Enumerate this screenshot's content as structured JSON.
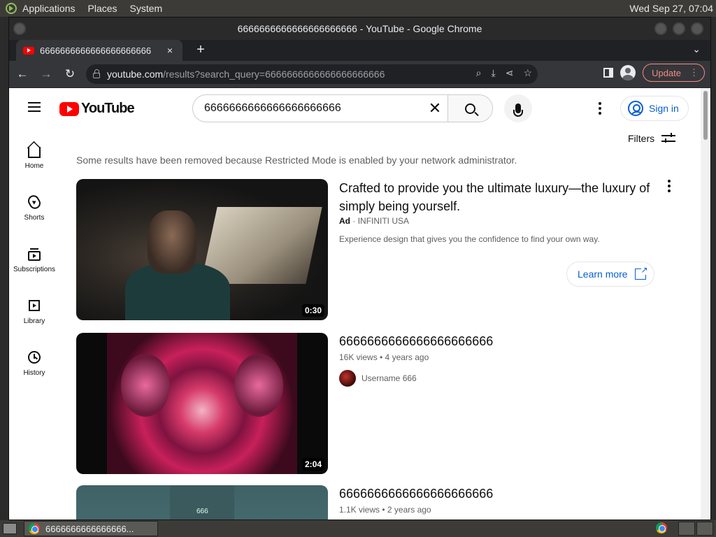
{
  "top_panel": {
    "menus": [
      "Applications",
      "Places",
      "System"
    ],
    "clock": "Wed Sep 27, 07:04"
  },
  "window": {
    "title": "6666666666666666666666 - YouTube - Google Chrome"
  },
  "tab": {
    "title": "6666666666666666666666",
    "close": "×",
    "new_tab": "+"
  },
  "omnibox": {
    "host": "youtube.com",
    "path": "/results?search_query=6666666666666666666666"
  },
  "toolbar": {
    "update_label": "Update"
  },
  "masthead": {
    "logo_text": "YouTube",
    "search_value": "6666666666666666666666",
    "signin_label": "Sign in"
  },
  "guide": [
    {
      "label": "Home",
      "icon": "home-icon"
    },
    {
      "label": "Shorts",
      "icon": "shorts-icon"
    },
    {
      "label": "Subscriptions",
      "icon": "subscriptions-icon"
    },
    {
      "label": "Library",
      "icon": "library-icon"
    },
    {
      "label": "History",
      "icon": "history-icon"
    }
  ],
  "filters_label": "Filters",
  "notice": "Some results have been removed because Restricted Mode is enabled by your network administrator.",
  "ad": {
    "title": "Crafted to provide you the ultimate luxury—the luxury of simply being yourself.",
    "ad_label": "Ad",
    "sep": "·",
    "advertiser": "INFINITI USA",
    "description": "Experience design that gives you the confidence to find your own way.",
    "duration": "0:30",
    "learn_more": "Learn more"
  },
  "videos": [
    {
      "title": "6666666666666666666666",
      "meta": "16K views • 4 years ago",
      "channel": "Username 666",
      "duration": "2:04"
    },
    {
      "title": "6666666666666666666666",
      "meta": "1.1K views • 2 years ago",
      "thumb_caption": "666"
    }
  ],
  "taskbar": {
    "task_title": "6666666666666666..."
  }
}
